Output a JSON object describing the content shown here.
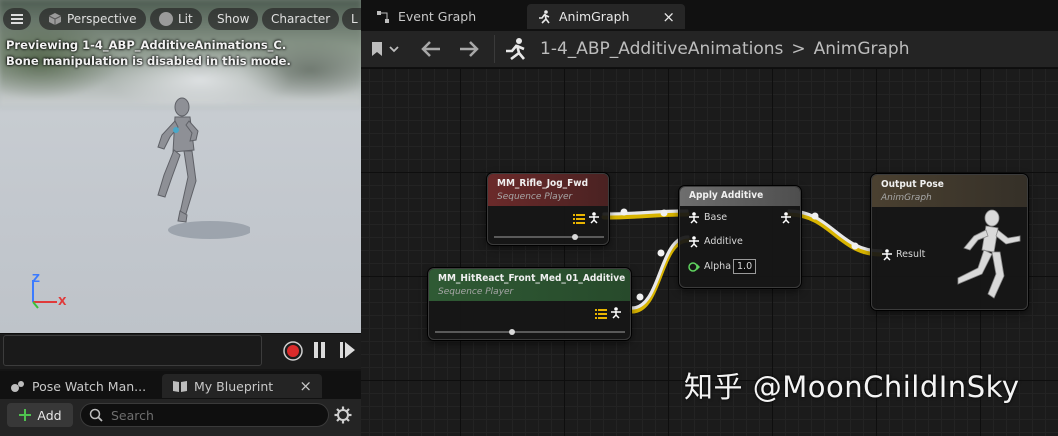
{
  "viewport": {
    "menu_icon": "hamburger-icon",
    "perspective_label": "Perspective",
    "lit_label": "Lit",
    "show_label": "Show",
    "character_label": "Character",
    "overflow_label": "L",
    "preview_message": "Previewing 1-4_ABP_AdditiveAnimations_C.",
    "bone_message": "Bone manipulation is disabled in this mode.",
    "axis_z": "Z",
    "axis_x": "X"
  },
  "playback": {
    "record_icon": "record-icon",
    "pause_icon": "pause-icon",
    "step_icon": "play-step-icon"
  },
  "bottom_tabs": {
    "pose_watch_label": "Pose Watch Man...",
    "my_blueprint_label": "My Blueprint",
    "close_symbol": "×"
  },
  "blueprint_toolbar": {
    "add_label": "Add",
    "search_placeholder": "Search"
  },
  "editor_tabs": {
    "event_graph_label": "Event Graph",
    "anim_graph_label": "AnimGraph",
    "close_symbol": "×"
  },
  "breadcrumb": {
    "blueprint": "1-4_ABP_AdditiveAnimations",
    "separator": ">",
    "graph": "AnimGraph"
  },
  "nodes": {
    "rifle_jog": {
      "title": "MM_Rifle_Jog_Fwd",
      "subtitle": "Sequence Player",
      "header_color": "#6b2a2a"
    },
    "hit_react": {
      "title": "MM_HitReact_Front_Med_01_Additive",
      "subtitle": "Sequence Player",
      "header_color": "#2f5a34"
    },
    "apply_additive": {
      "title": "Apply Additive",
      "base_label": "Base",
      "additive_label": "Additive",
      "alpha_label": "Alpha",
      "alpha_value": "1.0"
    },
    "output_pose": {
      "title": "Output Pose",
      "subtitle": "AnimGraph",
      "result_label": "Result"
    }
  },
  "watermark": "知乎 @MoonChildInSky",
  "colors": {
    "wire_pose": "#e8e8e8",
    "wire_exec_accent": "#d8b400",
    "alpha_pin": "#5fd35f"
  }
}
